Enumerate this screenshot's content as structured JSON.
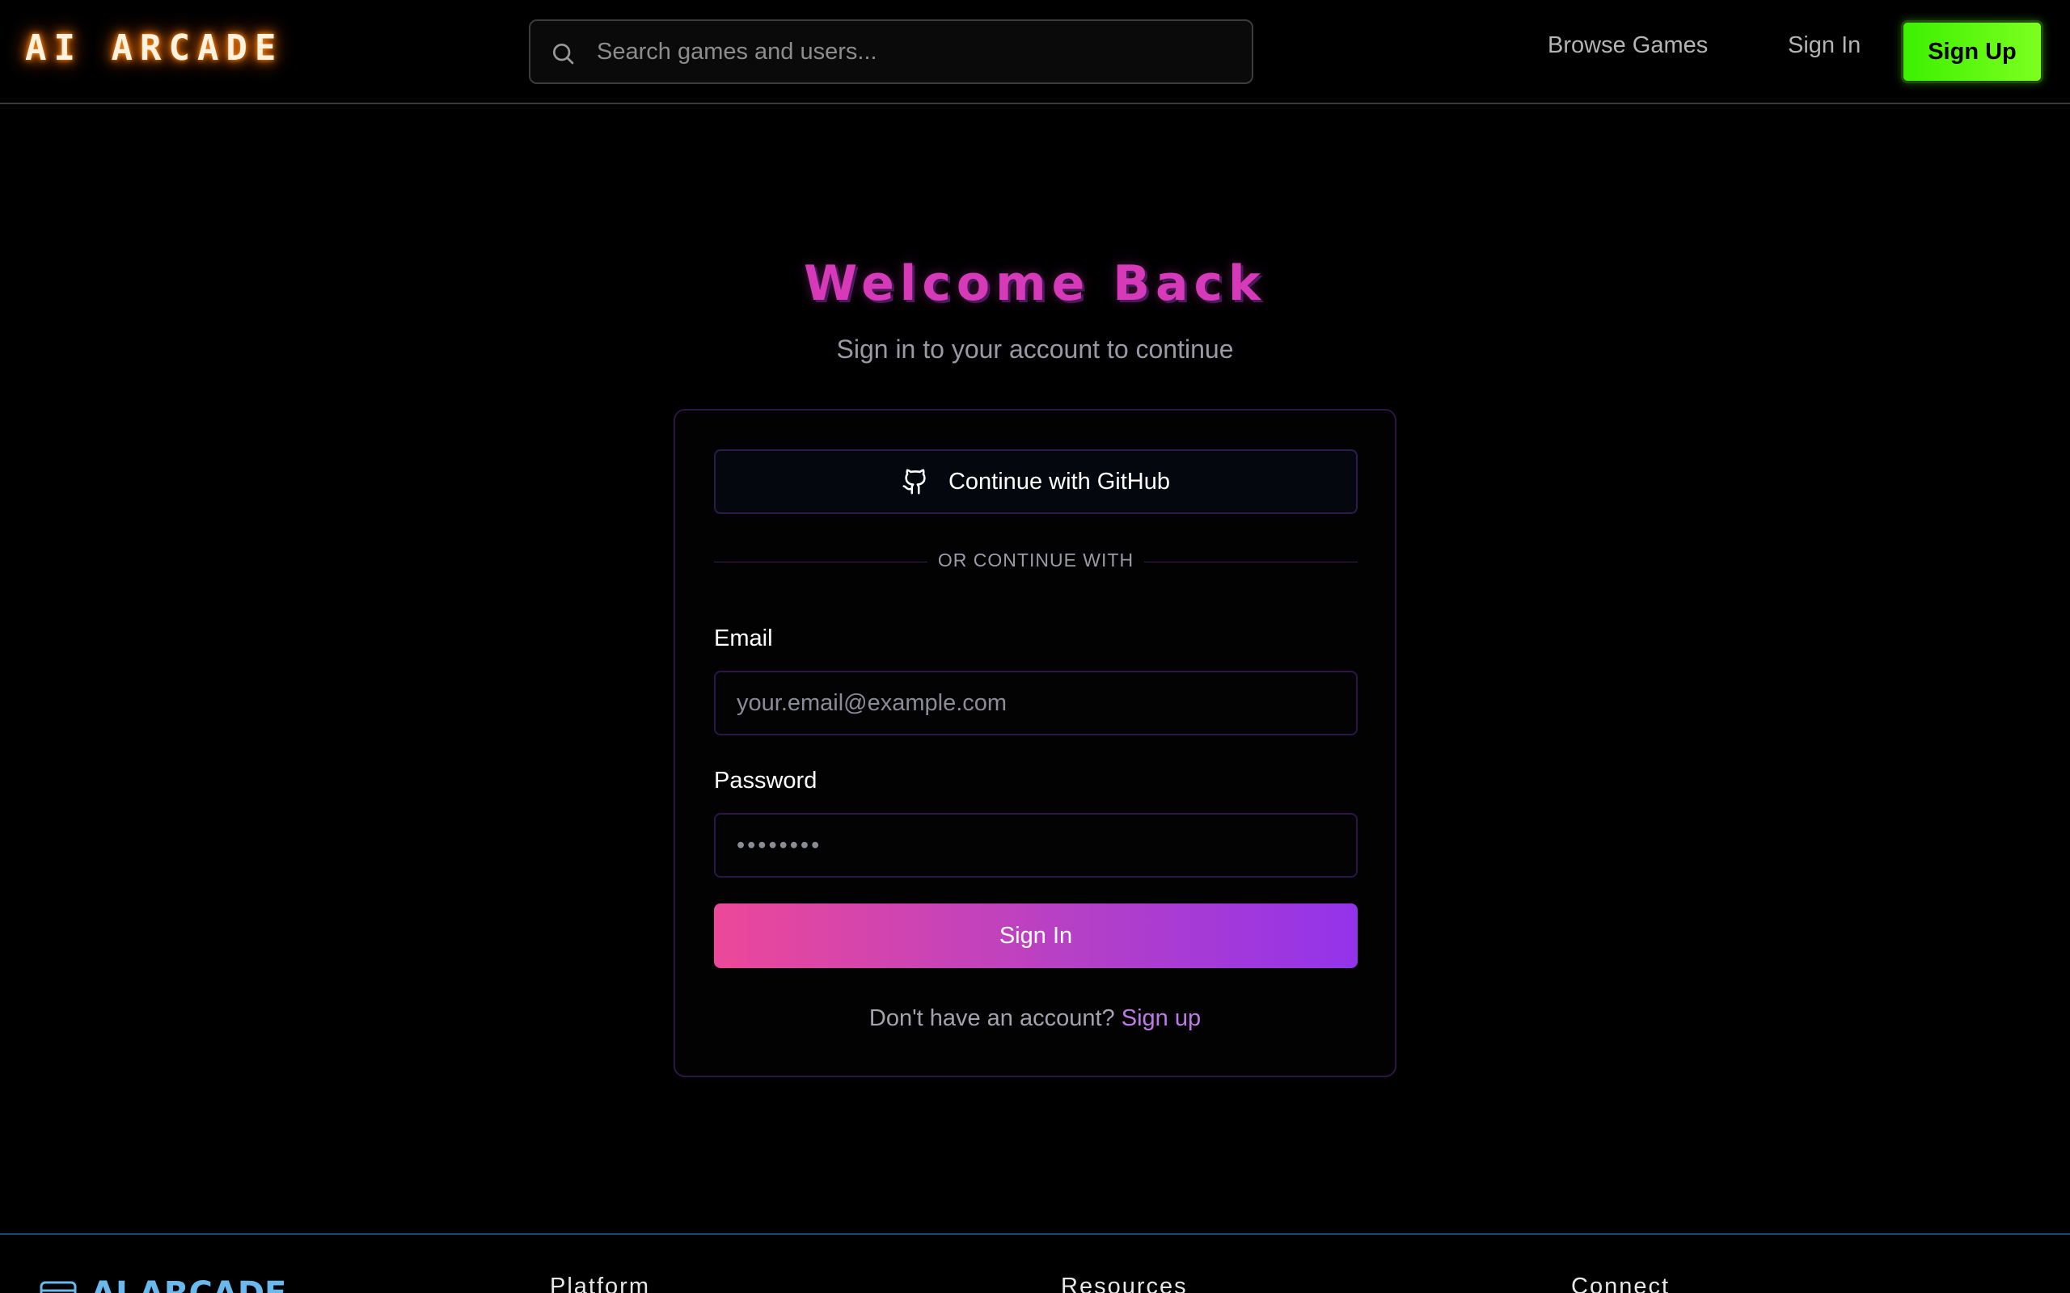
{
  "header": {
    "logo": "AI ARCADE",
    "search_placeholder": "Search games and users...",
    "nav": {
      "browse_games": "Browse Games",
      "sign_in": "Sign In",
      "sign_up": "Sign Up"
    }
  },
  "main": {
    "title": "Welcome Back",
    "subtitle": "Sign in to your account to continue",
    "github_button": "Continue with GitHub",
    "divider_text": "OR CONTINUE WITH",
    "email": {
      "label": "Email",
      "placeholder": "your.email@example.com",
      "value": ""
    },
    "password": {
      "label": "Password",
      "placeholder": "••••••••",
      "value": ""
    },
    "sign_in_button": "Sign In",
    "no_account_text": "Don't have an account?",
    "sign_up_link": "Sign up"
  },
  "footer": {
    "brand": "AI ARCADE",
    "columns": [
      "Platform",
      "Resources",
      "Connect"
    ]
  },
  "colors": {
    "logo_glow": "#ff7a00",
    "title": "#d63ab8",
    "signup_button": "#4cff00",
    "signin_gradient_start": "#ec4899",
    "signin_gradient_end": "#9333ea",
    "footer_border": "#0b4f7a"
  }
}
